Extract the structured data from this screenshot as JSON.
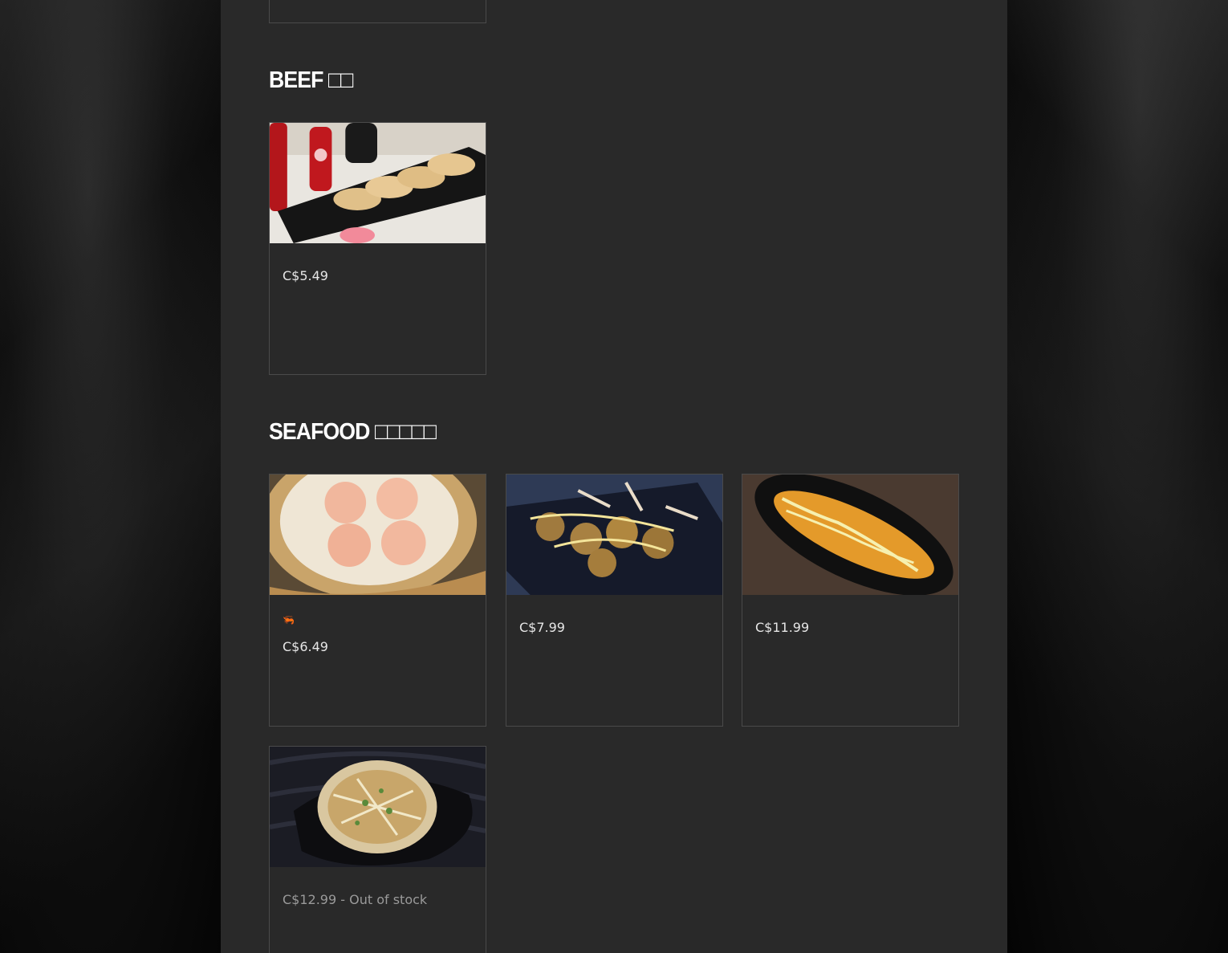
{
  "sections": {
    "beef": {
      "title": "BEEF □□"
    },
    "seafood": {
      "title": "SEAFOOD □□□□□"
    }
  },
  "items": {
    "beef_item": {
      "image": "pan-fried beef dumplings on black plate",
      "price": "C$5.49"
    },
    "seafood_1": {
      "image": "steamed shrimp dumplings in bamboo steamer",
      "icon": "shrimp-icon",
      "icon_char": "🦐",
      "price": "C$6.49"
    },
    "seafood_2": {
      "image": "takoyaki with bonito flakes",
      "price": "C$7.99"
    },
    "seafood_3": {
      "image": "fried seafood roll with mayo",
      "price": "C$11.99"
    },
    "seafood_4": {
      "image": "okonomiyaki with bonito flakes",
      "price": "C$12.99 - Out of stock"
    }
  },
  "colors": {
    "panel": "#292929",
    "border": "#4a4a4a",
    "text": "#e6e6e6",
    "muted": "#9a9a9a"
  }
}
